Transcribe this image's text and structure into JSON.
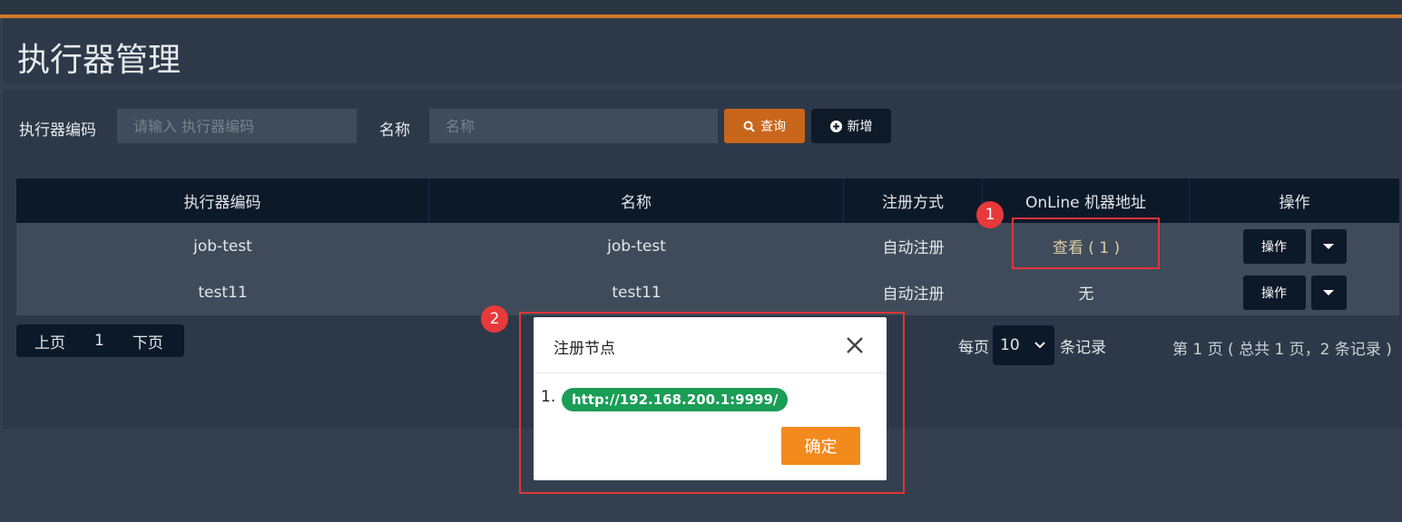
{
  "colors": {
    "accent": "#d0772a",
    "search_button": "#c8661c",
    "ok_button": "#f38a1d",
    "pill": "#1a9d56",
    "highlight": "#e2353a"
  },
  "page": {
    "title": "执行器管理"
  },
  "search": {
    "code_label": "执行器编码",
    "code_placeholder": "请输入 执行器编码",
    "name_label": "名称",
    "name_placeholder": "名称",
    "search_button": "查询",
    "add_button": "新增"
  },
  "table": {
    "headers": [
      "执行器编码",
      "名称",
      "注册方式",
      "OnLine 机器地址",
      "操作"
    ],
    "rows": [
      {
        "code": "job-test",
        "name": "job-test",
        "register": "自动注册",
        "online": "查看 ( 1 )",
        "op": "操作"
      },
      {
        "code": "test11",
        "name": "test11",
        "register": "自动注册",
        "online": "无",
        "op": "操作"
      }
    ]
  },
  "pagination": {
    "prev": "上页",
    "current": "1",
    "next": "下页",
    "per_page_prefix": "每页",
    "page_size": "10",
    "per_page_suffix": "条记录",
    "summary": "第 1 页 ( 总共 1 页，2 条记录 )"
  },
  "modal": {
    "title": "注册节点",
    "item_index": "1.",
    "address": "http://192.168.200.1:9999/",
    "ok_button": "确定"
  },
  "annotations": {
    "badge1": "1",
    "badge2": "2"
  }
}
